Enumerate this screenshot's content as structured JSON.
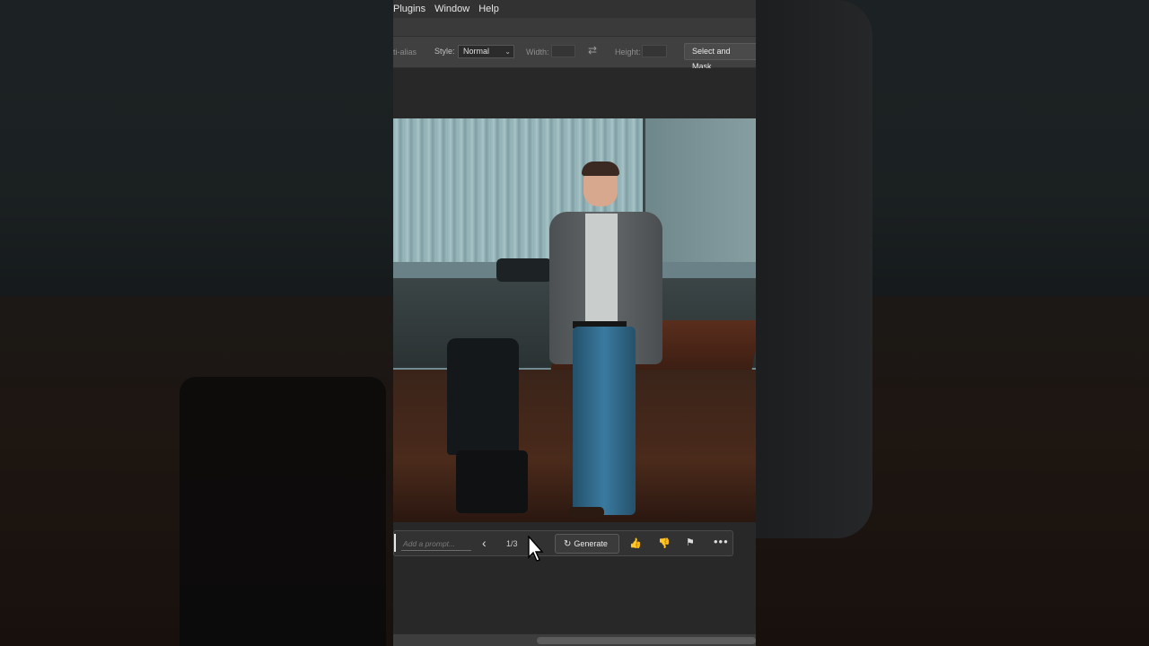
{
  "menu": {
    "items": [
      "Plugins",
      "Window",
      "Help"
    ]
  },
  "options": {
    "anti_alias": "ti-alias",
    "style_label": "Style:",
    "style_value": "Normal",
    "width_label": "Width:",
    "height_label": "Height:",
    "select_mask": "Select and Mask..."
  },
  "taskbar": {
    "prompt_placeholder": "Add a prompt...",
    "variation_count": "1/3",
    "generate_label": "Generate"
  },
  "icons": {
    "prev": "chevron-left-icon",
    "next": "chevron-right-icon",
    "generate": "refresh-icon",
    "thumbs_up": "thumbs-up-icon",
    "thumbs_down": "thumbs-down-icon",
    "flag": "flag-icon",
    "more": "more-icon"
  }
}
